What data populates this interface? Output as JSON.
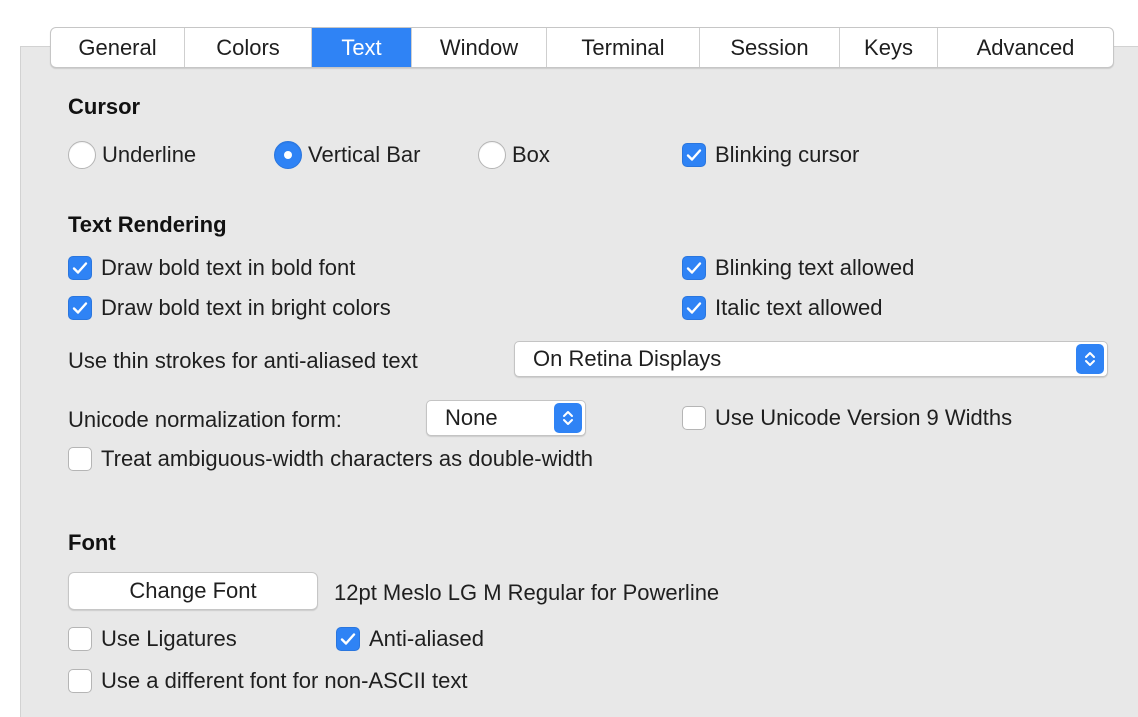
{
  "tabs": [
    {
      "label": "General",
      "selected": false
    },
    {
      "label": "Colors",
      "selected": false
    },
    {
      "label": "Text",
      "selected": true
    },
    {
      "label": "Window",
      "selected": false
    },
    {
      "label": "Terminal",
      "selected": false
    },
    {
      "label": "Session",
      "selected": false
    },
    {
      "label": "Keys",
      "selected": false
    },
    {
      "label": "Advanced",
      "selected": false
    }
  ],
  "cursor": {
    "title": "Cursor",
    "underline": {
      "label": "Underline",
      "selected": false
    },
    "vertical_bar": {
      "label": "Vertical Bar",
      "selected": true
    },
    "box": {
      "label": "Box",
      "selected": false
    },
    "blinking": {
      "label": "Blinking cursor",
      "checked": true
    }
  },
  "text_rendering": {
    "title": "Text Rendering",
    "bold_font": {
      "label": "Draw bold text in bold font",
      "checked": true
    },
    "bright_colors": {
      "label": "Draw bold text in bright colors",
      "checked": true
    },
    "blinking_text": {
      "label": "Blinking text allowed",
      "checked": true
    },
    "italic_text": {
      "label": "Italic text allowed",
      "checked": true
    },
    "thin_strokes_label": "Use thin strokes for anti-aliased text",
    "thin_strokes_value": "On Retina Displays",
    "normalization_label": "Unicode normalization form:",
    "normalization_value": "None",
    "unicode9": {
      "label": "Use Unicode Version 9 Widths",
      "checked": false
    },
    "ambiguous": {
      "label": "Treat ambiguous-width characters as double-width",
      "checked": false
    }
  },
  "font": {
    "title": "Font",
    "change_button": "Change Font",
    "current": "12pt Meslo LG M Regular for Powerline",
    "ligatures": {
      "label": "Use Ligatures",
      "checked": false
    },
    "anti_aliased": {
      "label": "Anti-aliased",
      "checked": true
    },
    "non_ascii": {
      "label": "Use a different font for non-ASCII text",
      "checked": false
    }
  },
  "colors": {
    "accent": "#2f83f5",
    "panel": "#e8e8e8"
  }
}
